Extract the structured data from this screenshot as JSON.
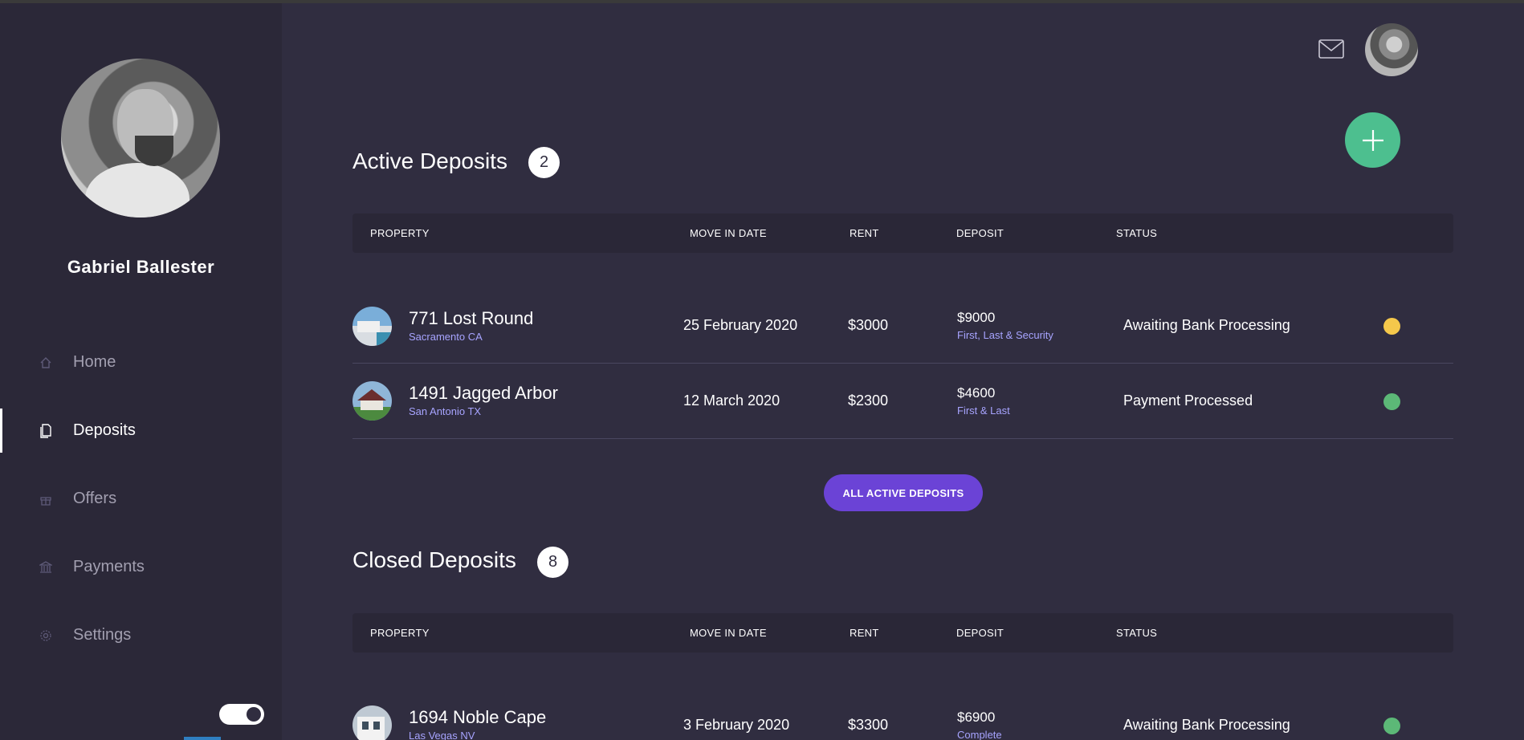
{
  "user": {
    "name": "Gabriel Ballester"
  },
  "nav": [
    {
      "label": "Home",
      "icon": "home-icon",
      "active": false
    },
    {
      "label": "Deposits",
      "icon": "document-icon",
      "active": true
    },
    {
      "label": "Offers",
      "icon": "gift-icon",
      "active": false
    },
    {
      "label": "Payments",
      "icon": "bank-icon",
      "active": false
    },
    {
      "label": "Settings",
      "icon": "gear-icon",
      "active": false
    }
  ],
  "colors": {
    "background": "#302d40",
    "sidebar": "#2b2838",
    "accent_green": "#4dbf8f",
    "accent_purple": "#6b43d6",
    "status_pending": "#f5c84b",
    "status_done": "#5cb877",
    "subtext": "#a7a4ff"
  },
  "columns": {
    "property": "PROPERTY",
    "move_in": "MOVE IN DATE",
    "rent": "RENT",
    "deposit": "DEPOSIT",
    "status": "STATUS"
  },
  "active": {
    "title": "Active Deposits",
    "count": "2",
    "rows": [
      {
        "name": "771 Lost Round",
        "city": "Sacramento CA",
        "move_in": "25 February 2020",
        "rent": "$3000",
        "deposit": "$9000",
        "deposit_note": "First, Last & Security",
        "status": "Awaiting Bank Processing",
        "status_color": "#f5c84b"
      },
      {
        "name": "1491 Jagged Arbor",
        "city": "San Antonio TX",
        "move_in": "12 March 2020",
        "rent": "$2300",
        "deposit": "$4600",
        "deposit_note": "First & Last",
        "status": "Payment Processed",
        "status_color": "#5cb877"
      }
    ],
    "button": "ALL ACTIVE DEPOSITS"
  },
  "closed": {
    "title": "Closed Deposits",
    "count": "8",
    "rows": [
      {
        "name": "1694 Noble Cape",
        "city": "Las Vegas NV",
        "move_in": "3 February 2020",
        "rent": "$3300",
        "deposit": "$6900",
        "deposit_note": "Complete",
        "status": "Awaiting Bank Processing",
        "status_color": "#5cb877"
      }
    ]
  }
}
